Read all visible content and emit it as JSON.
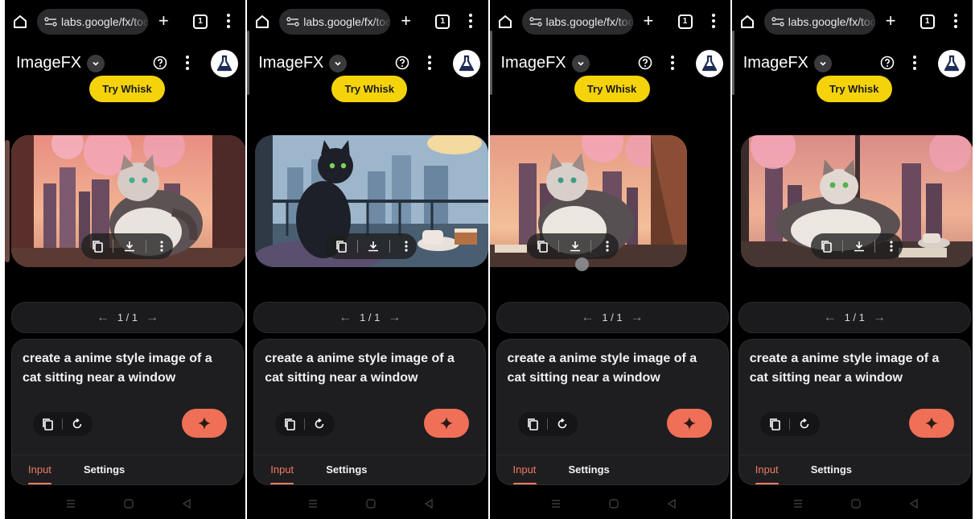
{
  "browser": {
    "url": "labs.google/fx/too",
    "tab_count": "1",
    "new_tab_symbol": "+"
  },
  "app": {
    "title": "ImageFX",
    "try_whisk_label": "Try Whisk"
  },
  "pager": {
    "prev": "←",
    "count": "1 / 1",
    "next": "→"
  },
  "prompt": {
    "text": "create a anime style image of a cat sitting near a window"
  },
  "tabs": {
    "input": "Input",
    "settings": "Settings"
  },
  "icons": [
    "home-icon",
    "site-settings-icon",
    "tabs-icon",
    "overflow-menu-icon",
    "chevron-down-icon",
    "help-icon",
    "labs-flask-icon",
    "copy-icon",
    "download-icon",
    "more-icon",
    "refresh-icon",
    "sparkle-icon",
    "recents-icon",
    "home-circle-icon",
    "back-icon"
  ],
  "colors": {
    "accent": "#f06f57",
    "whisk": "#f4d30a",
    "panel": "#1e1e20"
  }
}
